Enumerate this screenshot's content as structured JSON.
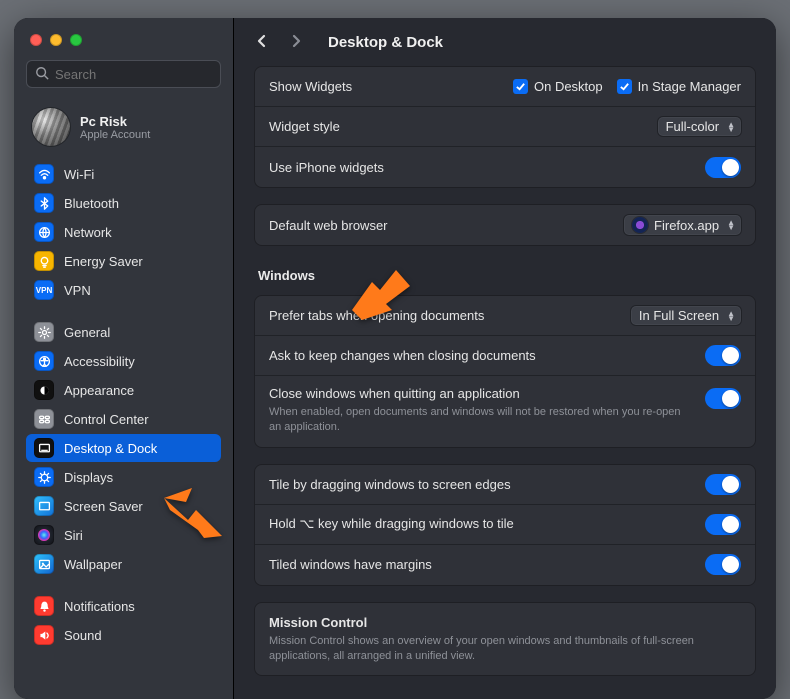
{
  "header": {
    "title": "Desktop & Dock"
  },
  "search": {
    "placeholder": "Search"
  },
  "account": {
    "name": "Pc Risk",
    "sub": "Apple Account"
  },
  "sidebar": {
    "items": [
      {
        "label": "Wi-Fi",
        "bg": "#0a6cf5",
        "icon": "wifi"
      },
      {
        "label": "Bluetooth",
        "bg": "#0a6cf5",
        "icon": "bt"
      },
      {
        "label": "Network",
        "bg": "#0a6cf5",
        "icon": "globe"
      },
      {
        "label": "Energy Saver",
        "bg": "#f7b500",
        "icon": "bulb"
      },
      {
        "label": "VPN",
        "bg": "#0a6cf5",
        "icon": "vpn"
      },
      {
        "label": "General",
        "bg": "#8e9198",
        "icon": "gear"
      },
      {
        "label": "Accessibility",
        "bg": "#0a6cf5",
        "icon": "access"
      },
      {
        "label": "Appearance",
        "bg": "#101010",
        "icon": "appear"
      },
      {
        "label": "Control Center",
        "bg": "#8e9198",
        "icon": "cc"
      },
      {
        "label": "Desktop & Dock",
        "bg": "#101010",
        "icon": "dock",
        "selected": true
      },
      {
        "label": "Displays",
        "bg": "#0a6cf5",
        "icon": "display"
      },
      {
        "label": "Screen Saver",
        "bg": "linear-gradient(135deg,#32c1ff,#116fd4)",
        "icon": "ss"
      },
      {
        "label": "Siri",
        "bg": "radial-gradient(circle,#2a3340,#101014)",
        "icon": "siri"
      },
      {
        "label": "Wallpaper",
        "bg": "linear-gradient(135deg,#2ec5ff,#1162cc)",
        "icon": "wall"
      },
      {
        "label": "Notifications",
        "bg": "#ff3b30",
        "icon": "bell"
      },
      {
        "label": "Sound",
        "bg": "#ff3b30",
        "icon": "sound"
      }
    ]
  },
  "widgets": {
    "show_label": "Show Widgets",
    "on_desktop": "On Desktop",
    "in_stage": "In Stage Manager",
    "style_label": "Widget style",
    "style_value": "Full-color",
    "iphone_label": "Use iPhone widgets"
  },
  "browser": {
    "label": "Default web browser",
    "value": "Firefox.app"
  },
  "windows": {
    "title": "Windows",
    "prefer_label": "Prefer tabs when opening documents",
    "prefer_value": "In Full Screen",
    "ask_label": "Ask to keep changes when closing documents",
    "close_label": "Close windows when quitting an application",
    "close_sub": "When enabled, open documents and windows will not be restored when you re-open an application.",
    "tile_edges": "Tile by dragging windows to screen edges",
    "hold_key": "Hold ⌥ key while dragging windows to tile",
    "margins": "Tiled windows have margins"
  },
  "mission": {
    "title": "Mission Control",
    "sub": "Mission Control shows an overview of your open windows and thumbnails of full-screen applications, all arranged in a unified view."
  }
}
